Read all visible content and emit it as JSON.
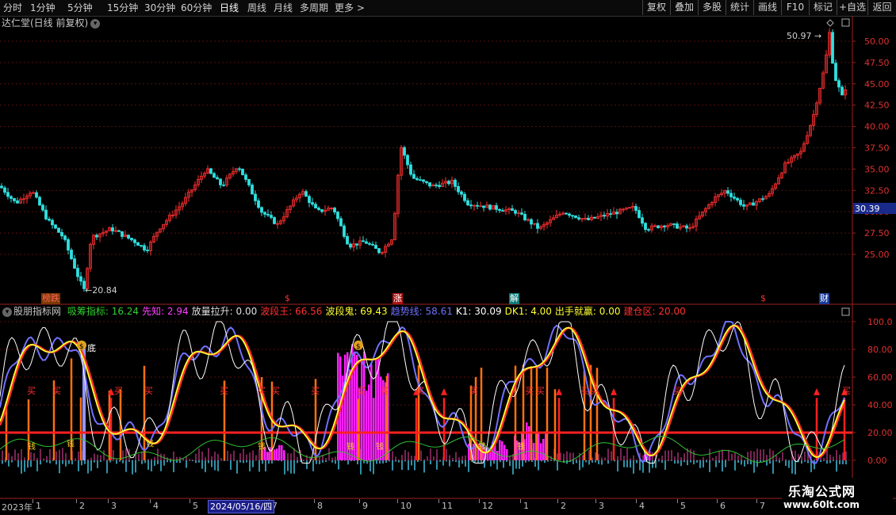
{
  "toolbar": {
    "periods": [
      "分时",
      "1分钟",
      "5分钟",
      "15分钟",
      "30分钟",
      "60分钟",
      "日线",
      "周线",
      "月线",
      "多周期",
      "更多"
    ],
    "more_arrow": ">",
    "active_period": "日线",
    "buttons": [
      "复权",
      "叠加",
      "多股",
      "统计",
      "画线",
      "F10",
      "标记",
      "+自选",
      "返回"
    ]
  },
  "price_panel": {
    "title": "达仁堂(日线 前复权)",
    "low_label": "←20.84",
    "high_label": "50.97",
    "current_price": "30.39",
    "axis_ticks": [
      "50.00",
      "47.50",
      "45.00",
      "42.50",
      "40.00",
      "37.50",
      "35.00",
      "32.50",
      "30.00",
      "27.50",
      "25.00"
    ],
    "events": [
      {
        "text": "榜跌",
        "color": "#ff6060",
        "bg": "#7a3a00"
      },
      {
        "text": "$",
        "color": "#ff3030",
        "bg": ""
      },
      {
        "text": "涨",
        "color": "#ffffff",
        "bg": "#b01010"
      },
      {
        "text": "解",
        "color": "#ffffff",
        "bg": "#0d7a7a"
      },
      {
        "text": "$",
        "color": "#ff3030",
        "bg": ""
      },
      {
        "text": "财",
        "color": "#ffffff",
        "bg": "#1a3a9a"
      }
    ]
  },
  "indicator_panel": {
    "name": "股朋指标网",
    "items": [
      {
        "label": "吸筹指标:",
        "value": "16.24",
        "color": "#30d030"
      },
      {
        "label": "先知:",
        "value": "2.94",
        "color": "#ff40ff"
      },
      {
        "label": "放量拉升:",
        "value": "0.00",
        "color": "#e0e0e0"
      },
      {
        "label": "波段王:",
        "value": "66.56",
        "color": "#ff3030"
      },
      {
        "label": "波段鬼:",
        "value": "69.43",
        "color": "#ffff30"
      },
      {
        "label": "趋势线:",
        "value": "58.61",
        "color": "#7070ff"
      },
      {
        "label": "K1:",
        "value": "30.09",
        "color": "#ffffff"
      },
      {
        "label": "DK1:",
        "value": "4.00",
        "color": "#ffff30"
      },
      {
        "label": "出手就赢:",
        "value": "0.00",
        "color": "#ffff30"
      },
      {
        "label": "建仓区:",
        "value": "20.00",
        "color": "#ff3030"
      }
    ],
    "axis_ticks": [
      "100.0",
      "80.00",
      "60.00",
      "40.00",
      "20.00",
      "0.00"
    ],
    "buy_label": "买",
    "bottom_label": "底",
    "money_icon": "money-bag-icon",
    "low_zone_label": "钱"
  },
  "date_axis": {
    "year": "2023年",
    "months": [
      "1",
      "2",
      "3",
      "4",
      "5",
      "7",
      "8",
      "9",
      "10",
      "11",
      "12",
      "1",
      "2",
      "3",
      "4",
      "5",
      "6",
      "7"
    ],
    "cursor_date": "2024/05/16/四"
  },
  "watermark": {
    "line1": "乐淘公式网",
    "line2": "www.60lt.com"
  },
  "colors": {
    "up": "#ff3030",
    "down": "#30e0e0",
    "accent": "#ff40ff",
    "trend": "#7070ff"
  }
}
